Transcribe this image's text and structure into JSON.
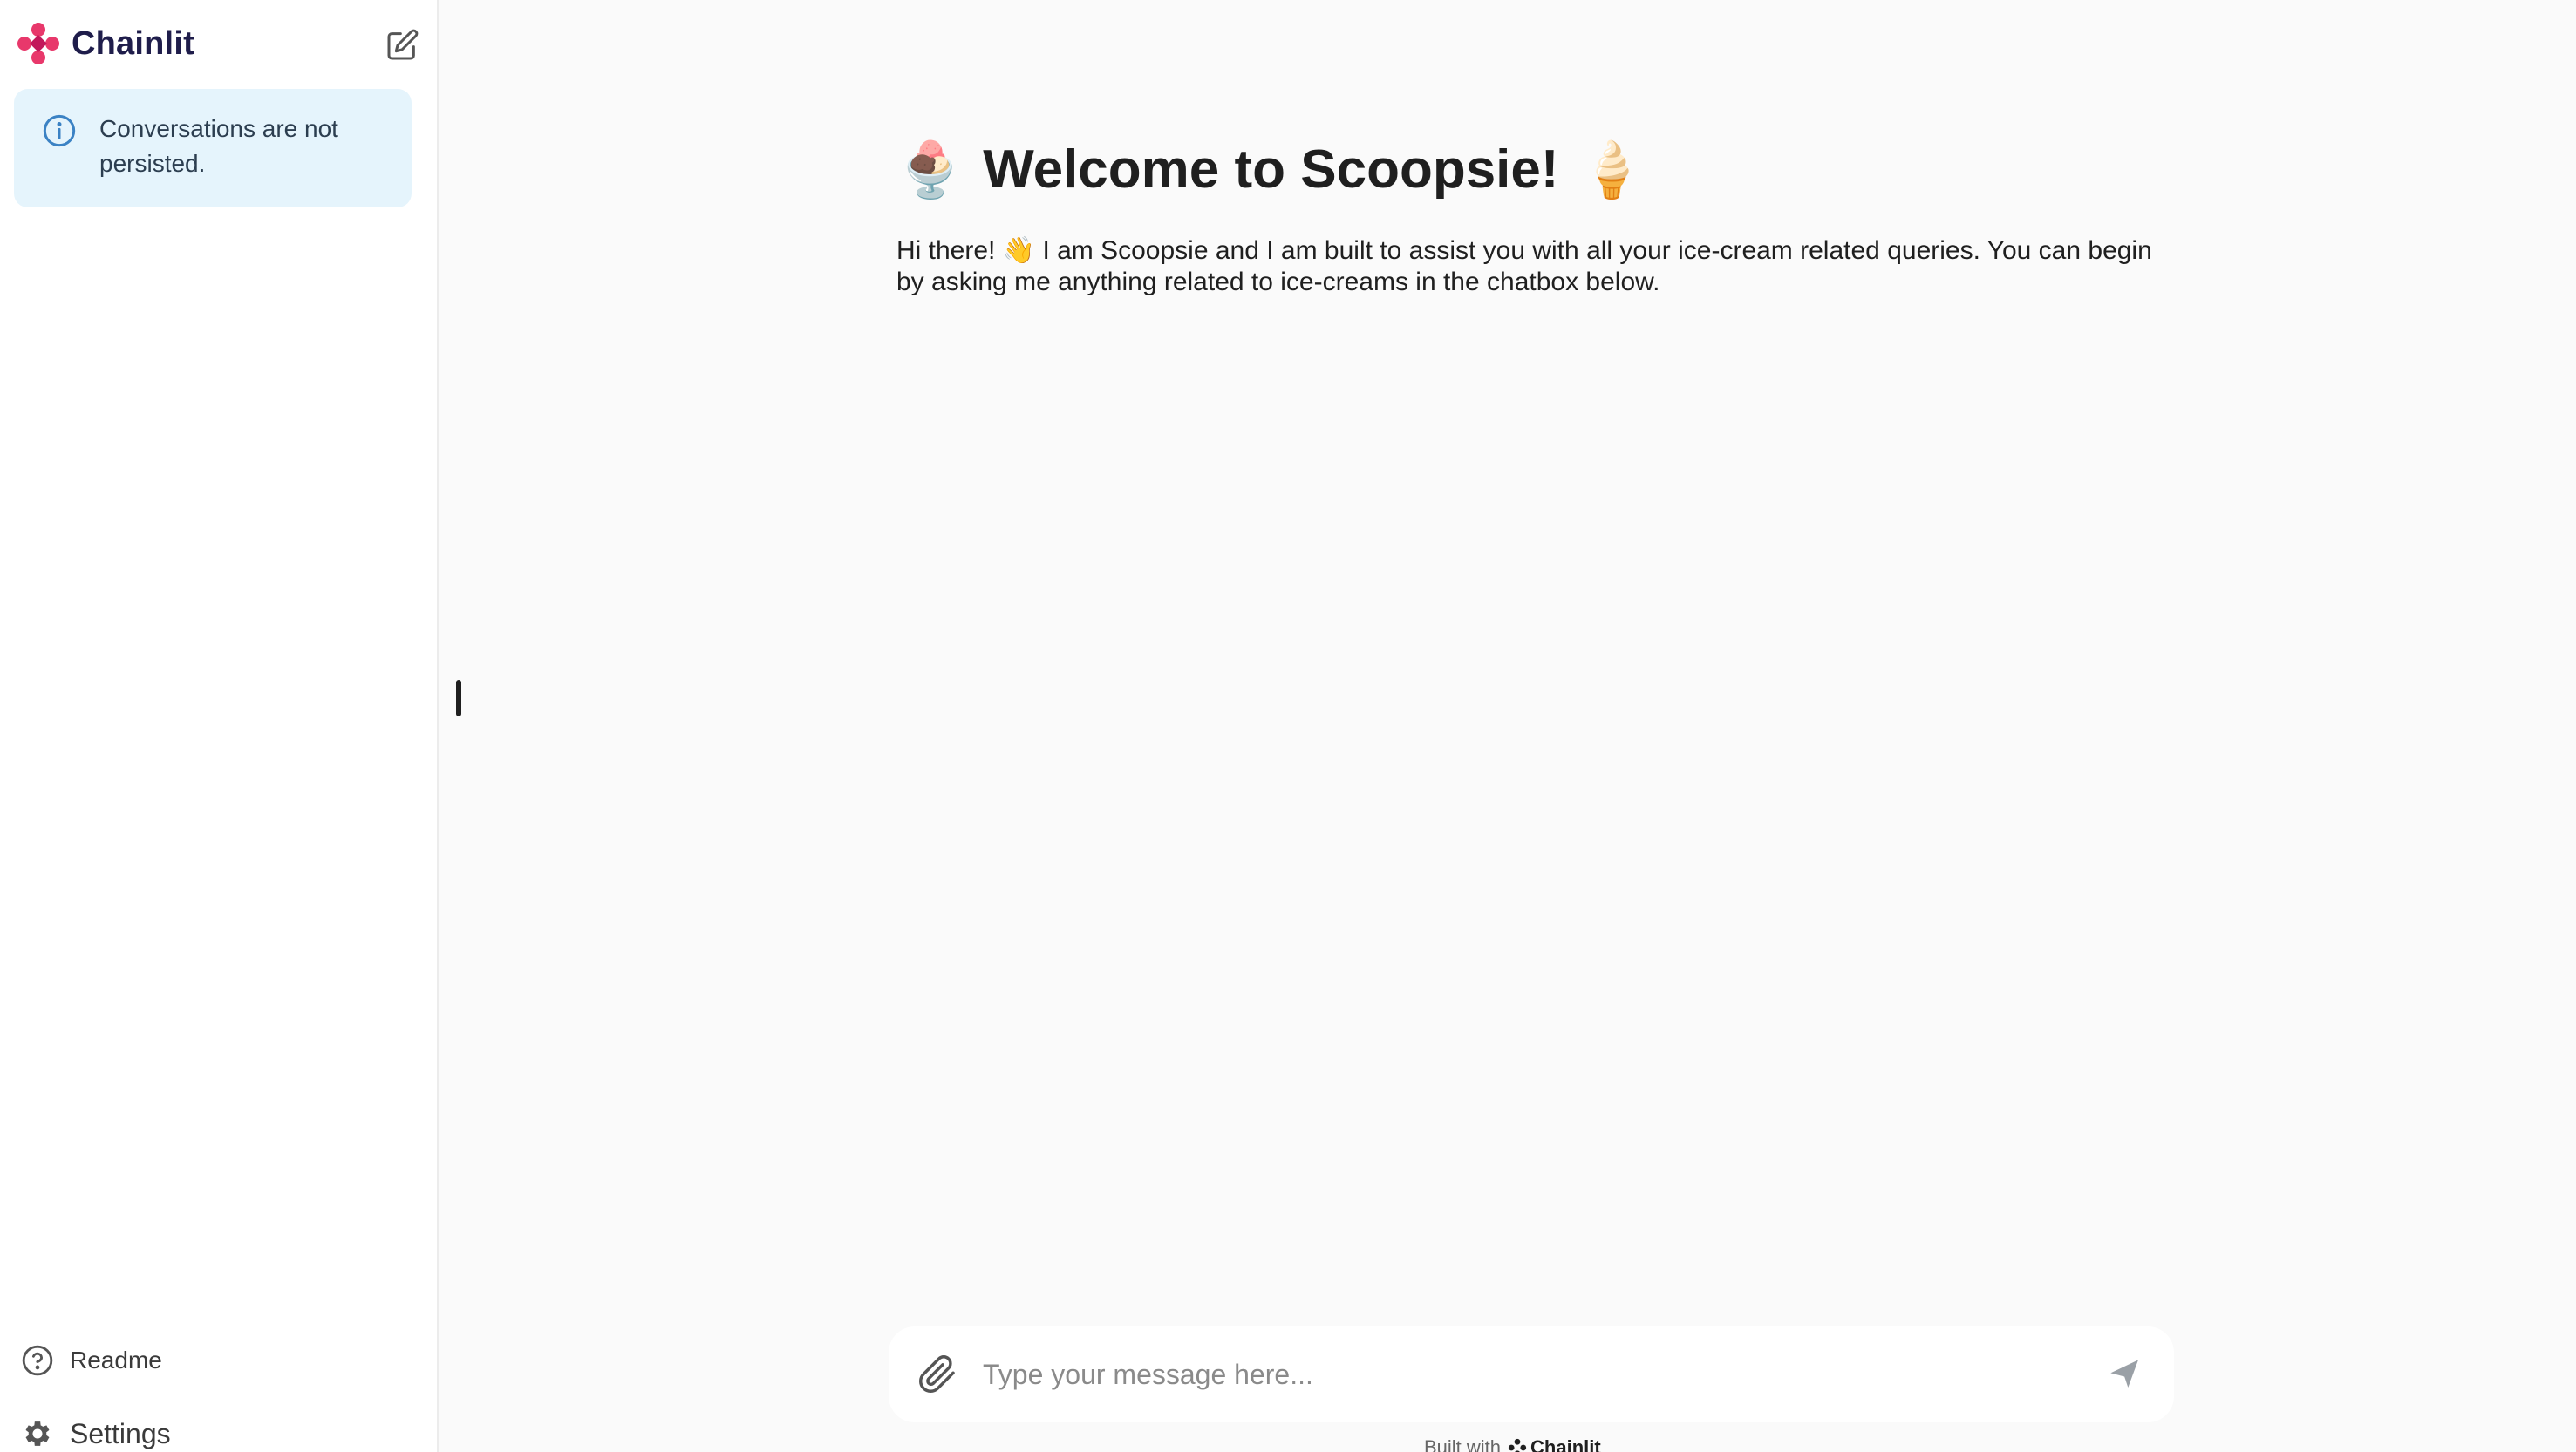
{
  "sidebar": {
    "brand_name": "Chainlit",
    "brand_icon": "chainlit-logo-icon",
    "new_chat_icon": "new-chat-icon",
    "notice": "Conversations are not persisted.",
    "footer": {
      "readme_label": "Readme",
      "settings_label": "Settings"
    }
  },
  "main": {
    "welcome_title": "Welcome to Scoopsie!",
    "title_emoji_left": "🍨",
    "title_emoji_right": "🍦",
    "welcome_text_before": "Hi there!",
    "welcome_emoji": "👋",
    "welcome_text_after": "I am Scoopsie and I am built to assist you with all your ice-cream related queries. You can begin by asking me anything related to ice-creams in the chatbox below."
  },
  "composer": {
    "placeholder": "Type your message here...",
    "value": ""
  },
  "built_with": {
    "prefix": "Built with",
    "brand": "Chainlit"
  },
  "colors": {
    "accent_pink": "#e8386b",
    "brand_navy": "#1f1d4b",
    "notice_bg": "#e5f4fc",
    "main_bg": "#fafafa"
  }
}
